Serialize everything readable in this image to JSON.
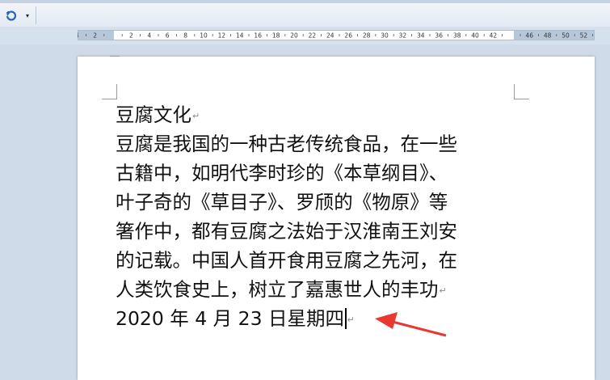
{
  "toolbar": {
    "undo_icon": "undo-icon",
    "more_icon": "qat-dropdown-icon",
    "more_glyph": "▾"
  },
  "ruler": {
    "left_labels": [
      "4",
      "2"
    ],
    "right_labels": [
      "2",
      "4",
      "6",
      "8",
      "10",
      "12",
      "14",
      "16",
      "18",
      "20",
      "22",
      "24",
      "26",
      "28",
      "30",
      "32",
      "34",
      "36",
      "38",
      "40",
      "42",
      "46",
      "48",
      "50",
      "52"
    ]
  },
  "document": {
    "paragraphs": [
      "豆腐文化",
      "豆腐是我国的一种古老传统食品，在一些",
      "古籍中，如明代李时珍的《本草纲目》、",
      "叶子奇的《草目子》、罗颀的《物原》等",
      "箸作中，都有豆腐之法始于汉淮南王刘安",
      "的记载。中国人首开食用豆腐之先河，在",
      "人类饮食史上，树立了嘉惠世人的丰功",
      "2020 年 4 月 23 日星期四"
    ],
    "paragraph_mark": "↵"
  },
  "annotation": {
    "color": "#e8382f"
  }
}
